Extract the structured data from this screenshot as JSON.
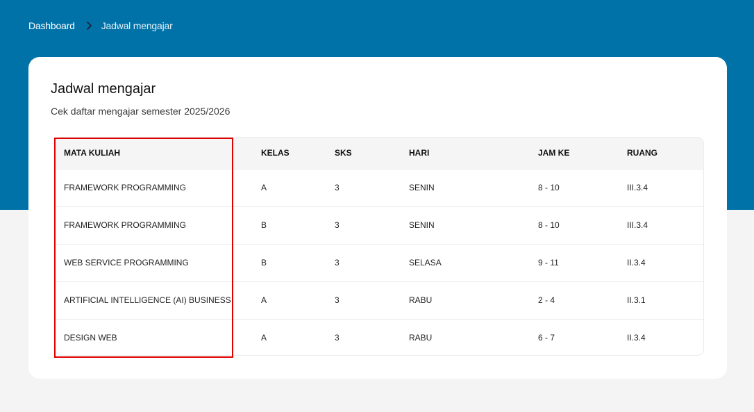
{
  "breadcrumb": {
    "home": "Dashboard",
    "separator_icon": "chevron-right-icon",
    "current": "Jadwal mengajar"
  },
  "card": {
    "title": "Jadwal mengajar",
    "subtitle": "Cek daftar mengajar semester 2025/2026"
  },
  "table": {
    "headers": [
      "MATA KULIAH",
      "KELAS",
      "SKS",
      "HARI",
      "JAM KE",
      "RUANG"
    ],
    "rows": [
      [
        "FRAMEWORK PROGRAMMING",
        "A",
        "3",
        "SENIN",
        "8 - 10",
        "III.3.4"
      ],
      [
        "FRAMEWORK PROGRAMMING",
        "B",
        "3",
        "SENIN",
        "8 - 10",
        "III.3.4"
      ],
      [
        "WEB SERVICE PROGRAMMING",
        "B",
        "3",
        "SELASA",
        "9 - 11",
        "II.3.4"
      ],
      [
        "ARTIFICIAL INTELLIGENCE (AI) BUSINESS",
        "A",
        "3",
        "RABU",
        "2 - 4",
        "II.3.1"
      ],
      [
        "DESIGN WEB",
        "A",
        "3",
        "RABU",
        "6 - 7",
        "II.3.4"
      ]
    ]
  },
  "colors": {
    "header_bg": "#0072a8",
    "page_bg": "#f4f4f4",
    "highlight": "#e00000"
  }
}
